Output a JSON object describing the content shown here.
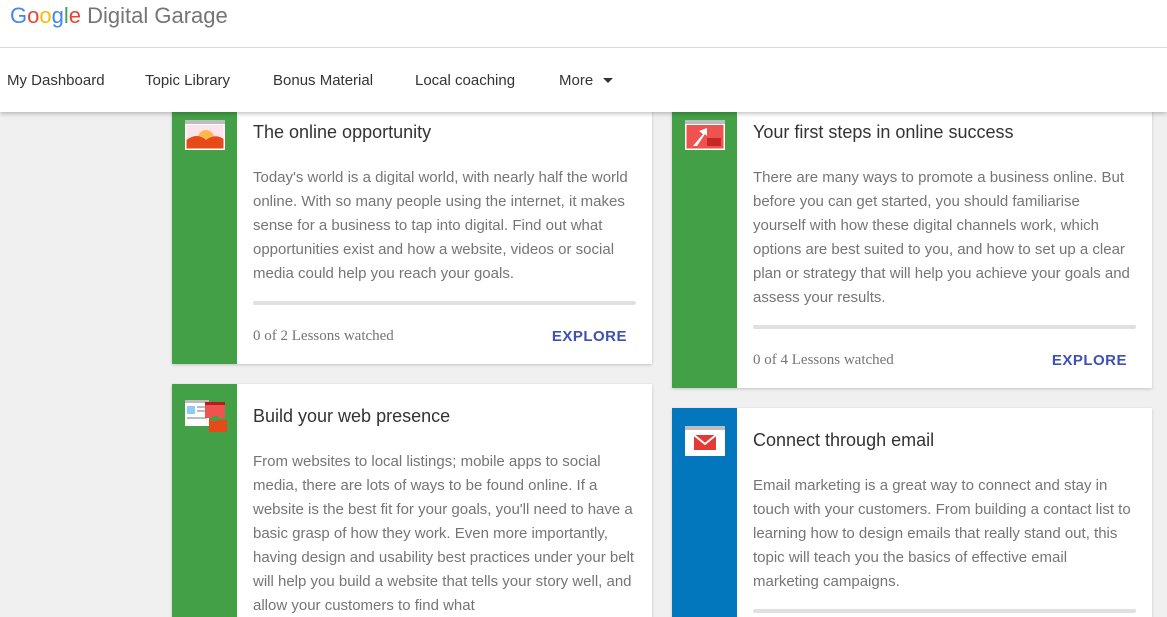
{
  "brand": {
    "google": [
      "G",
      "o",
      "o",
      "g",
      "l",
      "e"
    ],
    "product": " Digital Garage"
  },
  "nav": {
    "items": [
      "My Dashboard",
      "Topic Library",
      "Bonus Material",
      "Local coaching",
      "More"
    ]
  },
  "cards": [
    {
      "title": "The online opportunity",
      "description": "Today's world is a digital world, with nearly half the world online. With so many people using the internet, it makes sense for a business to tap into digital. Find out what opportunities exist and how a website, videos or social media could help you reach your goals.",
      "lessons": "0 of 2 Lessons watched",
      "explore": "EXPLORE",
      "accent": "#43a047",
      "icon": "sunrise-icon"
    },
    {
      "title": "Your first steps in online success",
      "description": "There are many ways to promote a business online. But before you can get started, you should familiarise yourself with how these digital channels work, which options are best suited to you, and how to set up a clear plan or strategy that will help you achieve your goals and assess your results.",
      "lessons": "0 of 4 Lessons watched",
      "explore": "EXPLORE",
      "accent": "#43a047",
      "icon": "growth-arrow-icon"
    },
    {
      "title": "Build your web presence",
      "description": "From websites to local listings; mobile apps to social media, there are lots of ways to be found online. If a website is the best fit for your goals, you'll need to have a basic grasp of how they work. Even more importantly, having design and usability best practices under your belt will help you build a website that tells your story well, and allow your customers to find what",
      "accent": "#43a047",
      "icon": "web-pages-icon"
    },
    {
      "title": "Connect through email",
      "description": "Email marketing is a great way to connect and stay in touch with your customers. From building a contact list to learning how to design emails that really stand out, this topic will teach you the basics of effective email marketing campaigns.",
      "accent": "#0277bd",
      "icon": "envelope-icon"
    }
  ]
}
